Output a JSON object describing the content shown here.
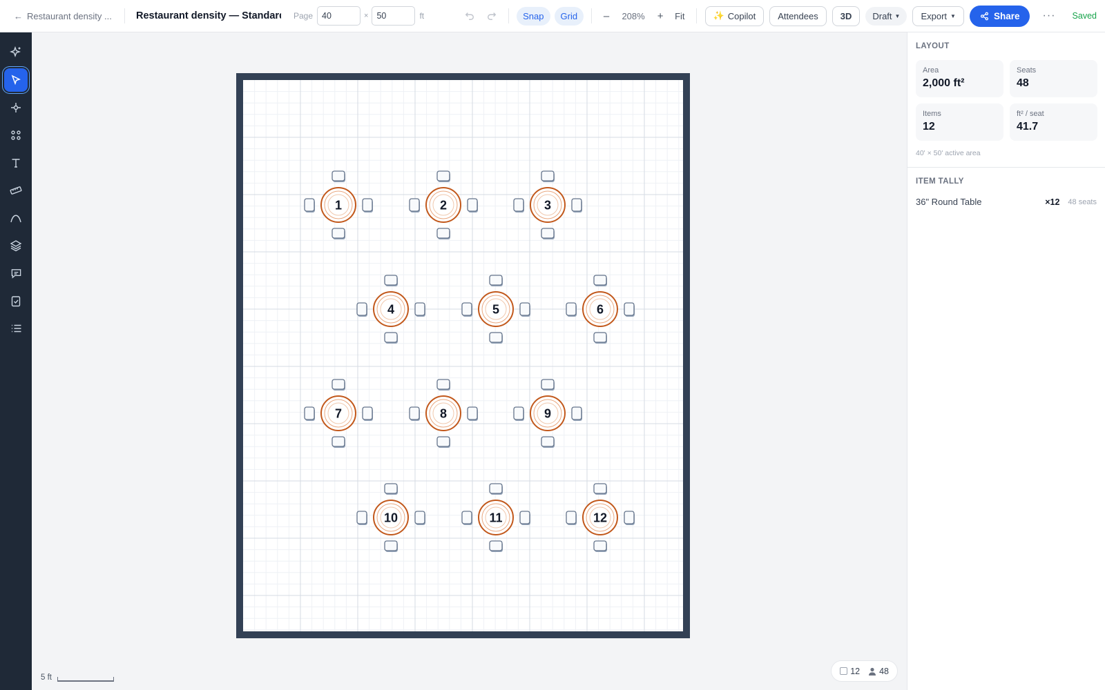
{
  "topbar": {
    "back_label": "Restaurant density ...",
    "title": "Restaurant density — Standard",
    "page_label": "Page",
    "width_value": "40",
    "times": "×",
    "height_value": "50",
    "unit": "ft",
    "snap": "Snap",
    "grid": "Grid",
    "zoom_out": "–",
    "zoom": "208%",
    "zoom_in": "+",
    "fit": "Fit",
    "copilot": "Copilot",
    "attendees": "Attendees",
    "view_3d": "3D",
    "status": "Draft",
    "export": "Export",
    "share": "Share",
    "more": "···",
    "saved": "Saved"
  },
  "rail": {
    "tools": [
      "sparkle-icon",
      "pointer-icon",
      "nodes-icon",
      "grid-dots-icon",
      "text-icon",
      "ruler-icon",
      "curve-icon",
      "layers-icon",
      "comment-icon",
      "checklist-icon",
      "list-icon"
    ],
    "active": "pointer-icon"
  },
  "floor": {
    "tables": [
      "1",
      "2",
      "3",
      "4",
      "5",
      "6",
      "7",
      "8",
      "9",
      "10",
      "11",
      "12"
    ],
    "table_color": "#c2581b",
    "wall_color": "#334155"
  },
  "canvas": {
    "scale_label": "5 ft",
    "item_count": "12",
    "seat_count": "48"
  },
  "panel": {
    "layout_title": "LAYOUT",
    "area_label": "Area",
    "area_value": "2,000 ft²",
    "seats_label": "Seats",
    "seats_value": "48",
    "items_label": "Items",
    "items_value": "12",
    "ratio_label": "ft² / seat",
    "ratio_value": "41.7",
    "active_area": "40' × 50' active area",
    "tally_title": "ITEM TALLY",
    "tally": [
      {
        "name": "36\" Round Table",
        "qty": "×12",
        "seats": "48 seats"
      }
    ]
  },
  "colors": {
    "accent": "#2563eb",
    "saved": "#16a34a",
    "rail": "#1f2937"
  }
}
